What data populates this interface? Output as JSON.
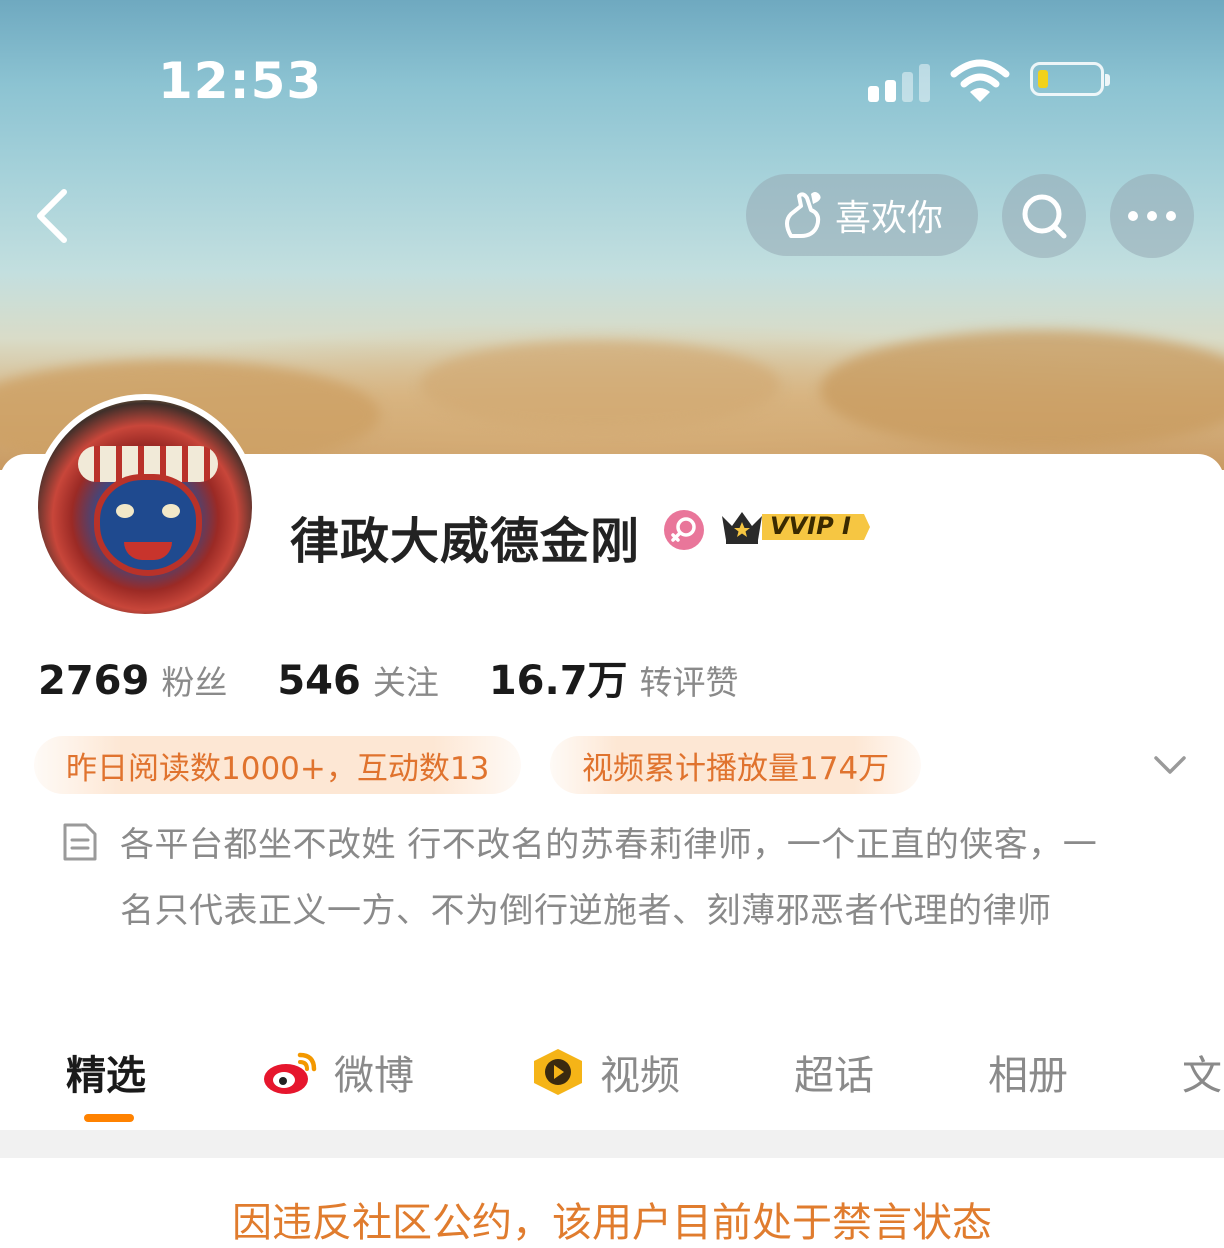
{
  "status_bar": {
    "time": "12:53"
  },
  "header": {
    "like_label": "喜欢你"
  },
  "profile": {
    "name": "律政大威德金刚",
    "badge_vip": "VVIP I",
    "stats": [
      {
        "value": "2769",
        "label": "粉丝"
      },
      {
        "value": "546",
        "label": "关注"
      },
      {
        "value": "16.7万",
        "label": "转评赞"
      }
    ],
    "highlights": [
      "昨日阅读数1000+，互动数13",
      "视频累计播放量174万"
    ],
    "bio": "各平台都坐不改姓 行不改名的苏春莉律师，一个正直的侠客，一名只代表正义一方、不为倒行逆施者、刻薄邪恶者代理的律师"
  },
  "tabs": [
    {
      "label": "精选",
      "active": true
    },
    {
      "label": "微博",
      "icon": "weibo-icon"
    },
    {
      "label": "视频",
      "icon": "video-icon"
    },
    {
      "label": "超话"
    },
    {
      "label": "相册"
    },
    {
      "label": "文"
    }
  ],
  "notice": "因违反社区公约，该用户目前处于禁言状态",
  "colors": {
    "accent": "#ff8200",
    "notice": "#e07c2e",
    "pill_bg": "#fde7d4",
    "pill_text": "#e0732e"
  }
}
